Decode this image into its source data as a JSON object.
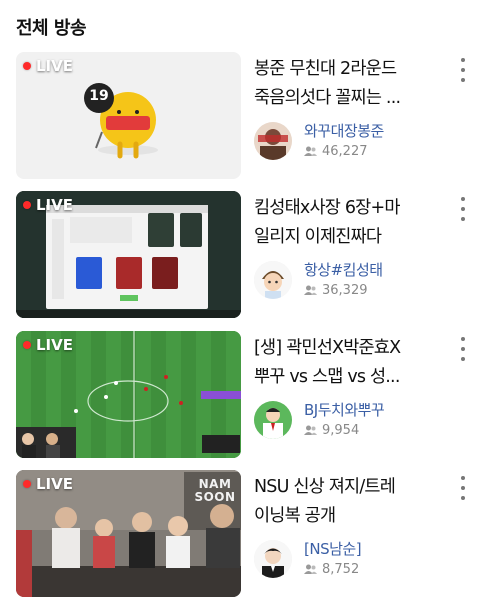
{
  "header": {
    "title": "전체 방송"
  },
  "live_label": "LIVE",
  "items": [
    {
      "title_line1": "봉준 무친대 2라운드",
      "title_line2": "죽음의섯다 꼴찌는 ...",
      "channel": "와꾸대장봉준",
      "viewers": "46,227",
      "thumb_badge": "19"
    },
    {
      "title_line1": "킴성태x사장 6장+마",
      "title_line2": "일리지 이제진짜다",
      "channel": "항상#킴성태",
      "viewers": "36,329"
    },
    {
      "title_line1": "[생] 곽민선X박준효X",
      "title_line2": "뿌꾸 vs 스맵 vs 성...",
      "channel": "BJ두치와뿌꾸",
      "viewers": "9,954"
    },
    {
      "title_line1": "NSU 신상 져지/트레",
      "title_line2": "이닝복 공개",
      "channel": "[NS남순]",
      "viewers": "8,752",
      "thumb_sign": "NAM SOON"
    }
  ],
  "colors": {
    "live_dot": "#ff2a2a",
    "channel_link": "#3b5fa5",
    "meta_gray": "#888888"
  },
  "icons": {
    "more": "more-vertical-icon",
    "viewers": "viewers-icon"
  }
}
